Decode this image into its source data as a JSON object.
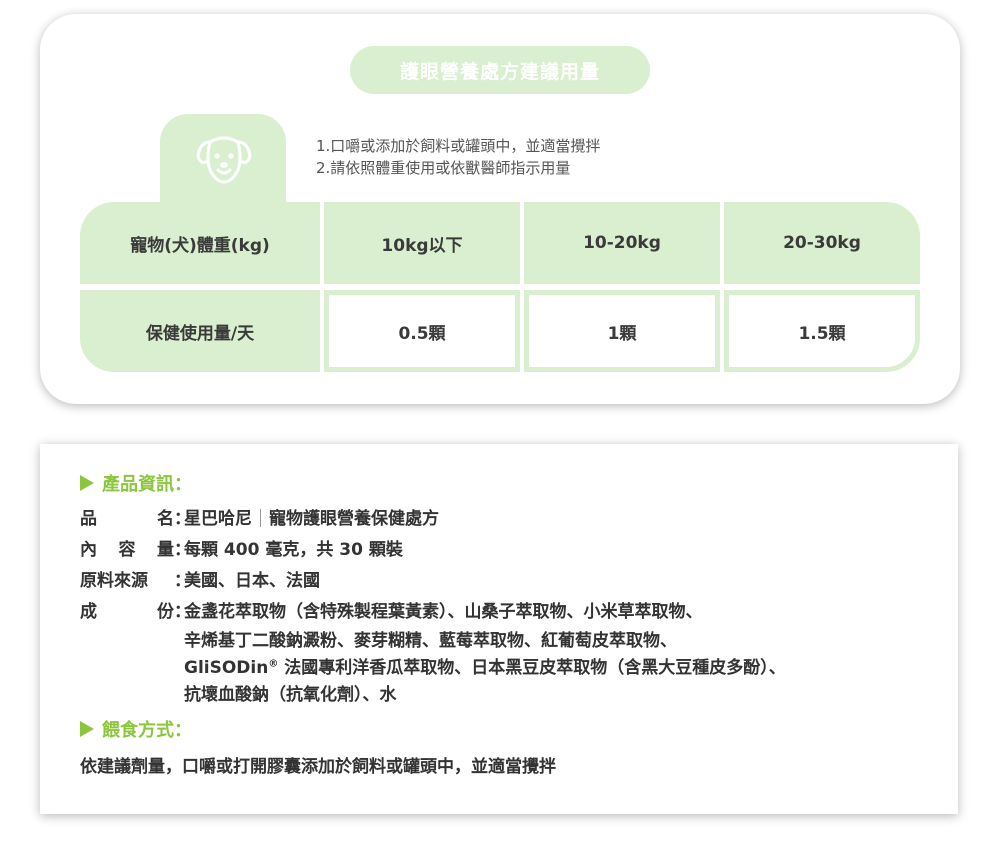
{
  "dosage": {
    "title": "護眼營養處方建議用量",
    "instructions": [
      "1.口嚼或添加於飼料或罐頭中，並適當攪拌",
      "2.請依照體重使用或依獸醫師指示用量"
    ],
    "header_label": "寵物(犬)體重(kg)",
    "weights": [
      "10kg以下",
      "10-20kg",
      "20-30kg"
    ],
    "row_label": "保健使用量/天",
    "doses": [
      "0.5顆",
      "1顆",
      "1.5顆"
    ],
    "icon": "dog-face-icon"
  },
  "product": {
    "section_title": "產品資訊：",
    "name_label": [
      "品",
      "名"
    ],
    "name_brand": "星巴哈尼",
    "name_value": "寵物護眼營養保健處方",
    "content_label": [
      "內",
      "容",
      "量"
    ],
    "content_value": "每顆 400 毫克，共 30 顆裝",
    "origin_label": "原料來源",
    "origin_value": "美國、日本、法國",
    "ingredients_label": [
      "成",
      "份"
    ],
    "ingredients": [
      "金盞花萃取物（含特殊製程葉黃素）、山桑子萃取物、小米草萃取物、",
      "辛烯基丁二酸鈉澱粉、麥芽糊精、藍莓萃取物、紅葡萄皮萃取物、",
      "法國專利洋香瓜萃取物、日本黑豆皮萃取物（含黑大豆種皮多酚）、",
      "抗壞血酸鈉（抗氧化劑）、水"
    ],
    "glisodin": "GliSODin",
    "registered": "®"
  },
  "feeding": {
    "section_title": "餵食方式：",
    "text": "依建議劑量，口嚼或打開膠囊添加於飼料或罐頭中，並適當攪拌"
  },
  "colors": {
    "accent_green": "#8cc63f",
    "light_green": "#d9efcf"
  }
}
